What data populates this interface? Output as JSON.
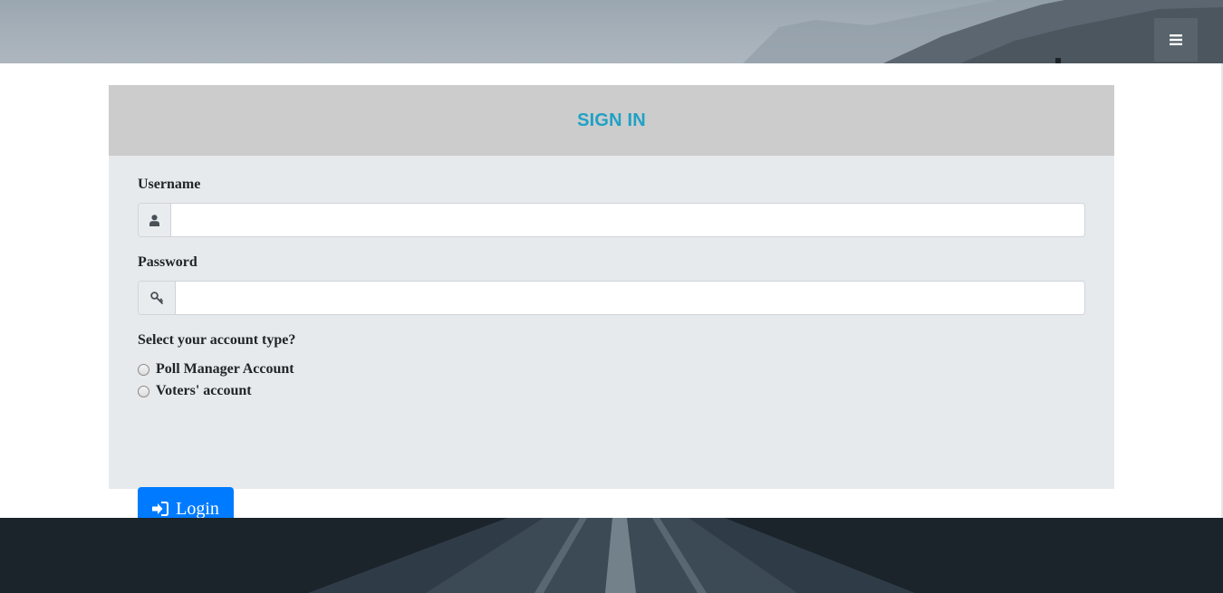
{
  "header": {
    "menu_icon": "hamburger-menu-icon"
  },
  "signin": {
    "title": "SIGN IN",
    "username": {
      "label": "Username",
      "icon": "user-icon",
      "value": "",
      "placeholder": ""
    },
    "password": {
      "label": "Password",
      "icon": "key-icon",
      "value": "",
      "placeholder": ""
    },
    "account_type": {
      "question": "Select your account type?",
      "options": [
        "Poll Manager Account",
        "Voters' account"
      ],
      "selected": null
    },
    "login_button": {
      "label": "Login",
      "icon": "sign-in-icon"
    }
  },
  "colors": {
    "title": "#1fa1c6",
    "header_bg": "#cccccc",
    "card_bg": "#e7eaed",
    "primary": "#007bff"
  }
}
